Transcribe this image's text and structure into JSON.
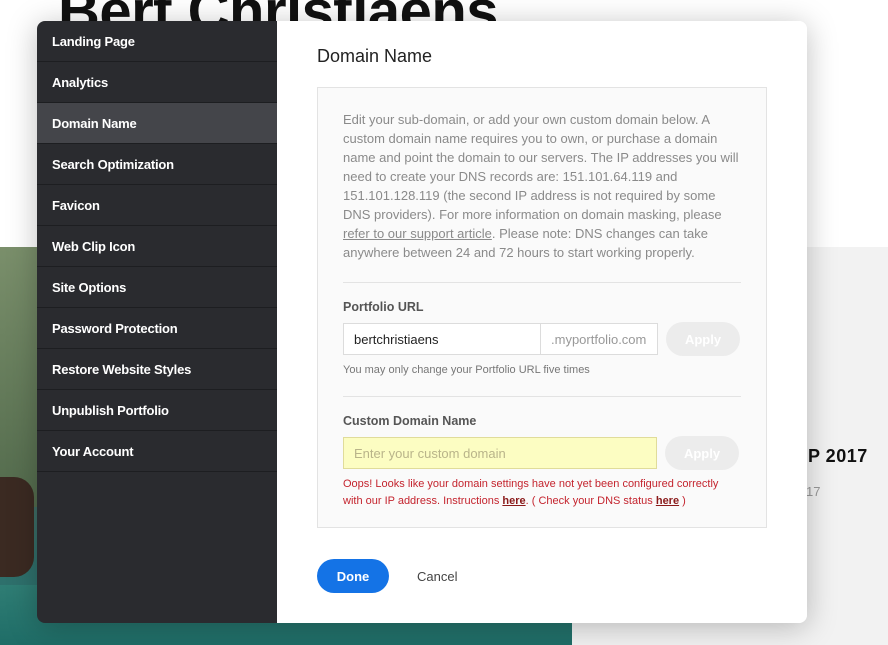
{
  "background": {
    "site_title": "Bert Christiaens",
    "project_title": "P 2017",
    "project_subtitle": "17"
  },
  "sidebar": {
    "items": [
      {
        "label": "Landing Page",
        "active": false
      },
      {
        "label": "Analytics",
        "active": false
      },
      {
        "label": "Domain Name",
        "active": true
      },
      {
        "label": "Search Optimization",
        "active": false
      },
      {
        "label": "Favicon",
        "active": false
      },
      {
        "label": "Web Clip Icon",
        "active": false
      },
      {
        "label": "Site Options",
        "active": false
      },
      {
        "label": "Password Protection",
        "active": false
      },
      {
        "label": "Restore Website Styles",
        "active": false
      },
      {
        "label": "Unpublish Portfolio",
        "active": false
      },
      {
        "label": "Your Account",
        "active": false
      }
    ]
  },
  "dialog": {
    "title": "Domain Name",
    "description_part1": "Edit your sub-domain, or add your own custom domain below. A custom domain name requires you to own, or purchase a domain name and point the domain to our servers. The IP addresses you will need to create your DNS records are: 151.101.64.119 and 151.101.128.119 (the second IP address is not required by some DNS providers). For more information on domain masking, please ",
    "description_link": "refer to our support article",
    "description_part2": ". Please note: DNS changes can take anywhere between 24 and 72 hours to start working properly.",
    "portfolio_url": {
      "label": "Portfolio URL",
      "value": "bertchristiaens",
      "suffix": ".myportfolio.com",
      "apply_label": "Apply",
      "hint": "You may only change your Portfolio URL five times"
    },
    "custom_domain": {
      "label": "Custom Domain Name",
      "placeholder": "Enter your custom domain",
      "apply_label": "Apply",
      "error_part1": "Oops! Looks like your domain settings have not yet been configured correctly with our IP address. Instructions ",
      "error_link1": "here",
      "error_part2": ". ( Check your DNS status ",
      "error_link2": "here",
      "error_part3": " )"
    },
    "done_label": "Done",
    "cancel_label": "Cancel"
  },
  "colors": {
    "sidebar_bg": "#2a2b2f",
    "sidebar_active": "#44454a",
    "primary": "#1473e6",
    "error": "#c4242e",
    "domain_input_bg": "#fcfdc2"
  }
}
